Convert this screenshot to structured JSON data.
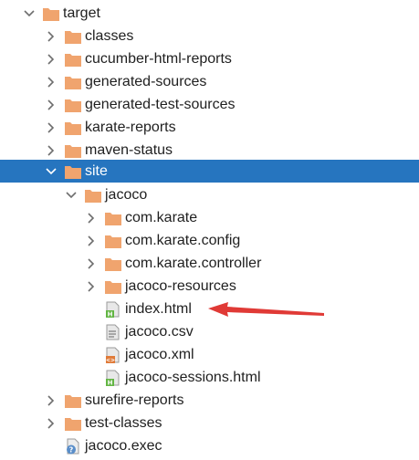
{
  "tree": {
    "items": [
      {
        "label": "target",
        "type": "folder",
        "expanded": true
      },
      {
        "label": "classes",
        "type": "folder",
        "expanded": false
      },
      {
        "label": "cucumber-html-reports",
        "type": "folder",
        "expanded": false
      },
      {
        "label": "generated-sources",
        "type": "folder",
        "expanded": false
      },
      {
        "label": "generated-test-sources",
        "type": "folder",
        "expanded": false
      },
      {
        "label": "karate-reports",
        "type": "folder",
        "expanded": false
      },
      {
        "label": "maven-status",
        "type": "folder",
        "expanded": false
      },
      {
        "label": "site",
        "type": "folder",
        "expanded": true,
        "selected": true
      },
      {
        "label": "jacoco",
        "type": "folder",
        "expanded": true
      },
      {
        "label": "com.karate",
        "type": "folder",
        "expanded": false
      },
      {
        "label": "com.karate.config",
        "type": "folder",
        "expanded": false
      },
      {
        "label": "com.karate.controller",
        "type": "folder",
        "expanded": false
      },
      {
        "label": "jacoco-resources",
        "type": "folder",
        "expanded": false
      },
      {
        "label": "index.html",
        "type": "html-file"
      },
      {
        "label": "jacoco.csv",
        "type": "text-file"
      },
      {
        "label": "jacoco.xml",
        "type": "xml-file"
      },
      {
        "label": "jacoco-sessions.html",
        "type": "html-file"
      },
      {
        "label": "surefire-reports",
        "type": "folder",
        "expanded": false
      },
      {
        "label": "test-classes",
        "type": "folder",
        "expanded": false
      },
      {
        "label": "jacoco.exec",
        "type": "unknown-file"
      }
    ]
  },
  "colors": {
    "folder": "#f0a46e",
    "selection": "#2675bf",
    "arrow": "#e03a36",
    "chevron": "#6e6e6e"
  }
}
